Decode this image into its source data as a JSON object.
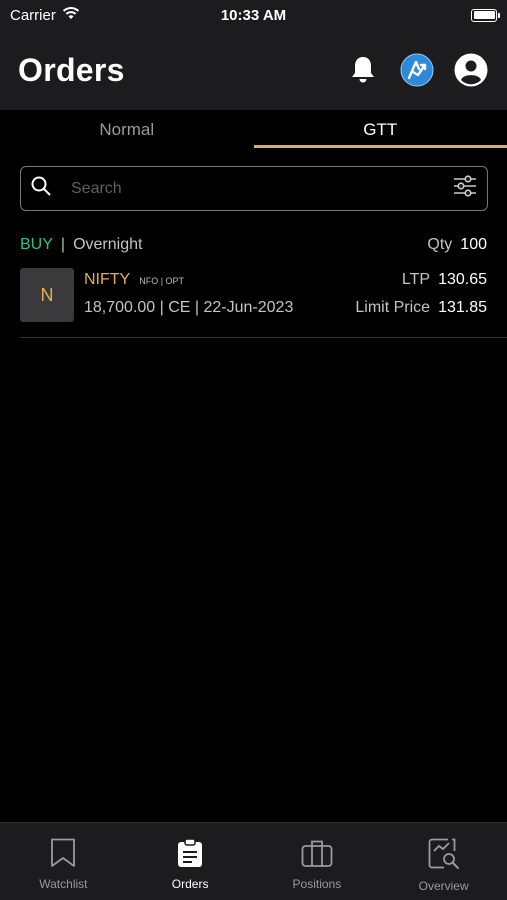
{
  "status_bar": {
    "carrier": "Carrier",
    "time": "10:33 AM"
  },
  "header": {
    "title": "Orders"
  },
  "tabs": [
    {
      "label": "Normal"
    },
    {
      "label": "GTT"
    }
  ],
  "search": {
    "placeholder": "Search"
  },
  "orders": [
    {
      "side": "BUY",
      "product": "Overnight",
      "qty_label": "Qty",
      "qty": "100",
      "avatar_letter": "N",
      "symbol": "NIFTY",
      "exchange": "NFO | OPT",
      "details": "18,700.00 | CE | 22-Jun-2023",
      "ltp_label": "LTP",
      "ltp": "130.65",
      "limit_label": "Limit Price",
      "limit_price": "131.85"
    }
  ],
  "bottom_nav": [
    {
      "label": "Watchlist"
    },
    {
      "label": "Orders"
    },
    {
      "label": "Positions"
    },
    {
      "label": "Overview"
    }
  ],
  "colors": {
    "accent": "#e0b054",
    "buy": "#2ec27e",
    "badge": "#2e8ad8"
  }
}
